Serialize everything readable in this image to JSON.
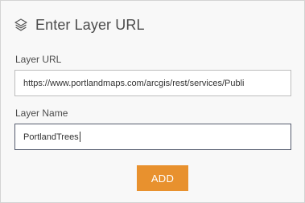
{
  "header": {
    "icon": "layers-icon",
    "title": "Enter Layer URL"
  },
  "form": {
    "url_label": "Layer URL",
    "url_value": "https://www.portlandmaps.com/arcgis/rest/services/Publi",
    "name_label": "Layer Name",
    "name_value": "PortlandTrees"
  },
  "actions": {
    "add_label": "ADD",
    "add_color": "#e8912e"
  }
}
